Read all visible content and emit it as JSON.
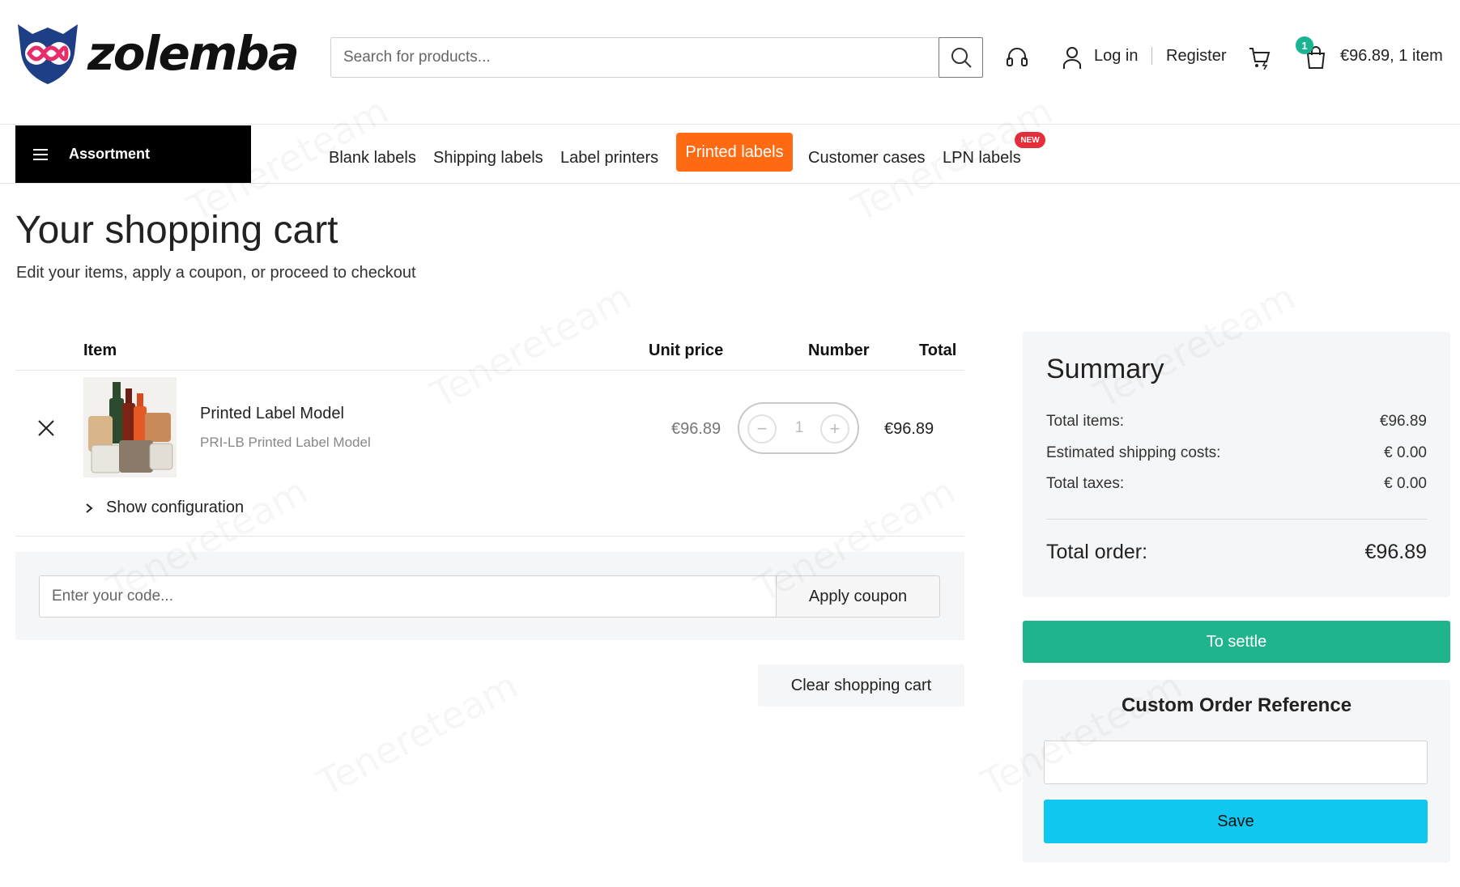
{
  "brand": {
    "name": "zolemba"
  },
  "header": {
    "search_placeholder": "Search for products...",
    "login_label": "Log in",
    "register_label": "Register",
    "cart_count": "1",
    "cart_summary": "€96.89, 1 item"
  },
  "nav": {
    "assortment_label": "Assortment",
    "items": [
      "Blank labels",
      "Shipping labels",
      "Label printers",
      "Printed labels",
      "Customer cases",
      "LPN labels"
    ],
    "active_index": 3,
    "new_badge": "NEW"
  },
  "page": {
    "title": "Your shopping cart",
    "subtitle": "Edit your items, apply a coupon, or proceed to checkout"
  },
  "cart_table": {
    "headers": {
      "item": "Item",
      "unit_price": "Unit price",
      "number": "Number",
      "total": "Total"
    },
    "items": [
      {
        "name": "Printed Label Model",
        "sku": "PRI-LB Printed Label Model",
        "unit_price": "€96.89",
        "quantity": "1",
        "total": "€96.89",
        "show_config_label": "Show configuration"
      }
    ]
  },
  "coupon": {
    "placeholder": "Enter your code...",
    "apply_label": "Apply coupon"
  },
  "clear_cart_label": "Clear shopping cart",
  "summary": {
    "title": "Summary",
    "rows": [
      {
        "label": "Total items:",
        "value": "€96.89"
      },
      {
        "label": "Estimated shipping costs:",
        "value": "€ 0.00"
      },
      {
        "label": "Total taxes:",
        "value": "€ 0.00"
      }
    ],
    "total_label": "Total order:",
    "total_value": "€96.89",
    "settle_label": "To settle"
  },
  "order_reference": {
    "title": "Custom Order Reference",
    "save_label": "Save"
  },
  "watermark_text": "Tenereteam",
  "colors": {
    "accent_orange": "#ff6a13",
    "badge_green": "#1ab394",
    "settle_green": "#20b48c",
    "save_cyan": "#0fc7ef",
    "new_red": "#e52e3a",
    "logo_blue": "#1e3f86",
    "logo_pink": "#e52e6a"
  }
}
